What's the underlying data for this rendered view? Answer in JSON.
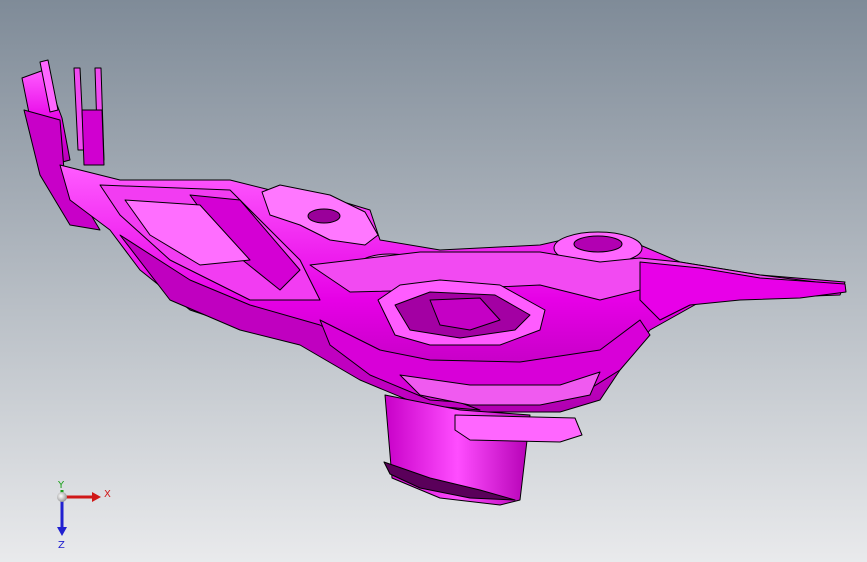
{
  "viewport": {
    "background_top": "#7f8b98",
    "background_bottom": "#e9eaec"
  },
  "part": {
    "fill": "#e600e6",
    "highlight": "#ff6bff",
    "shadow": "#8a008a",
    "edge": "#000000"
  },
  "triad": {
    "x_label": "X",
    "y_label": "Y",
    "z_label": "Z",
    "x_color": "#d01818",
    "y_color": "#1aa01a",
    "z_color": "#2020d0"
  }
}
